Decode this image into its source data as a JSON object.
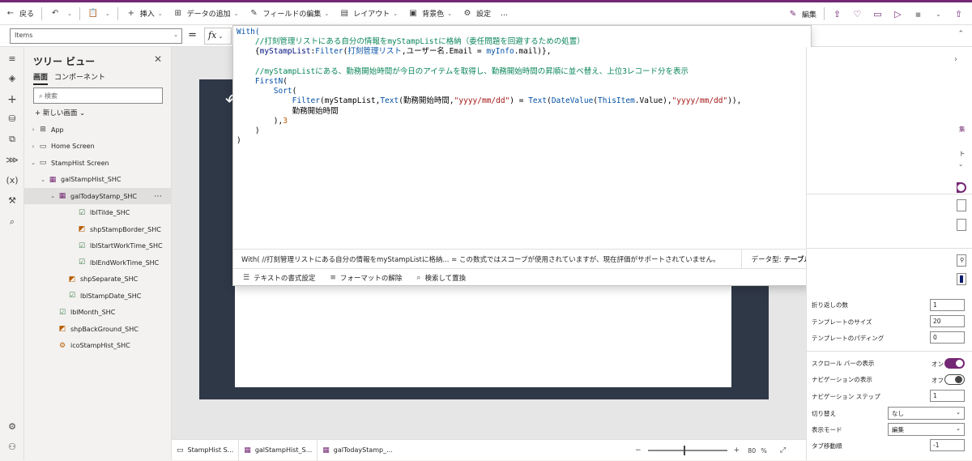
{
  "toolbar": {
    "back": "戻る",
    "insert": "挿入",
    "add_data": "データの追加",
    "edit_fields": "フィールドの編集",
    "layout": "レイアウト",
    "background": "背景色",
    "settings": "設定",
    "more": "…",
    "edit": "編集"
  },
  "formula_bar": {
    "property": "Items",
    "equals": "=",
    "fx": "fx"
  },
  "code_lines": [
    {
      "parts": [
        {
          "t": "With(",
          "c": "fn"
        }
      ]
    },
    {
      "parts": [
        {
          "t": "    //打刻管理リストにある自分の情報をmyStampListに格納（委任問題を回避するための処置）",
          "c": "cm"
        }
      ]
    },
    {
      "parts": [
        {
          "t": "    {",
          "c": ""
        },
        {
          "t": "myStampList",
          "c": "var"
        },
        {
          "t": ":",
          "c": ""
        },
        {
          "t": "Filter",
          "c": "fn"
        },
        {
          "t": "(",
          "c": ""
        },
        {
          "t": "打刻管理リスト",
          "c": "fn"
        },
        {
          "t": ",ユーザー名.Email = ",
          "c": ""
        },
        {
          "t": "myInfo",
          "c": "fn"
        },
        {
          "t": ".mail)},",
          "c": ""
        }
      ]
    },
    {
      "parts": [
        {
          "t": "",
          "c": ""
        }
      ]
    },
    {
      "parts": [
        {
          "t": "    //myStampListにある、勤務開始時間が今日のアイテムを取得し、勤務開始時間の昇順に並べ替え、上位3レコード分を表示",
          "c": "cm"
        }
      ]
    },
    {
      "parts": [
        {
          "t": "    FirstN",
          "c": "fn"
        },
        {
          "t": "(",
          "c": ""
        }
      ]
    },
    {
      "parts": [
        {
          "t": "        Sort",
          "c": "fn"
        },
        {
          "t": "(",
          "c": ""
        }
      ]
    },
    {
      "parts": [
        {
          "t": "            Filter",
          "c": "fn"
        },
        {
          "t": "(myStampList,",
          "c": ""
        },
        {
          "t": "Text",
          "c": "fn"
        },
        {
          "t": "(勤務開始時間,",
          "c": ""
        },
        {
          "t": "\"yyyy/mm/dd\"",
          "c": "str"
        },
        {
          "t": ") = ",
          "c": ""
        },
        {
          "t": "Text",
          "c": "fn"
        },
        {
          "t": "(",
          "c": ""
        },
        {
          "t": "DateValue",
          "c": "fn"
        },
        {
          "t": "(",
          "c": ""
        },
        {
          "t": "ThisItem",
          "c": "fn"
        },
        {
          "t": ".Value),",
          "c": ""
        },
        {
          "t": "\"yyyy/mm/dd\"",
          "c": "str"
        },
        {
          "t": ")),",
          "c": ""
        }
      ]
    },
    {
      "parts": [
        {
          "t": "            勤務開始時間",
          "c": ""
        }
      ]
    },
    {
      "parts": [
        {
          "t": "        ),",
          "c": ""
        },
        {
          "t": "3",
          "c": "num"
        }
      ]
    },
    {
      "parts": [
        {
          "t": "    )",
          "c": ""
        }
      ]
    },
    {
      "parts": [
        {
          "t": ")",
          "c": ""
        }
      ]
    }
  ],
  "editor_status": {
    "message": "With( //打刻管理リストにある自分の情報をmyStampListに格納...  =  この数式ではスコープが使用されていますが、現在評価がサポートされていません。",
    "type_label": "データ型:",
    "type_value": "テーブル"
  },
  "editor_tools": {
    "format_text": "テキストの書式設定",
    "remove_format": "フォーマットの解除",
    "find_replace": "検索して置換"
  },
  "tree": {
    "title": "ツリー ビュー",
    "tab_screens": "画面",
    "tab_components": "コンポーネント",
    "search_placeholder": "検索",
    "new_screen": "新しい画面",
    "items": [
      {
        "label": "App",
        "icon": "app-icon",
        "exp": "›",
        "indent": 0
      },
      {
        "label": "Home Screen",
        "icon": "screen-icon",
        "exp": "›",
        "indent": 0
      },
      {
        "label": "StampHist Screen",
        "icon": "screen-icon",
        "exp": "⌄",
        "indent": 0
      },
      {
        "label": "galStampHist_SHC",
        "icon": "gallery-icon",
        "exp": "⌄",
        "indent": 1
      },
      {
        "label": "galTodayStamp_SHC",
        "icon": "gallery-icon",
        "exp": "⌄",
        "indent": 2
      },
      {
        "label": "lblTilde_SHC",
        "icon": "label-icon",
        "exp": "",
        "indent": 4
      },
      {
        "label": "shpStampBorder_SHC",
        "icon": "shape-icon",
        "exp": "",
        "indent": 4
      },
      {
        "label": "lblStartWorkTime_SHC",
        "icon": "label-icon",
        "exp": "",
        "indent": 4
      },
      {
        "label": "lblEndWorkTime_SHC",
        "icon": "label-icon",
        "exp": "",
        "indent": 4
      },
      {
        "label": "shpSeparate_SHC",
        "icon": "shape-icon",
        "exp": "",
        "indent": 3
      },
      {
        "label": "lblStampDate_SHC",
        "icon": "label-icon",
        "exp": "",
        "indent": 3
      },
      {
        "label": "lblMonth_SHC",
        "icon": "label-icon",
        "exp": "",
        "indent": 2
      },
      {
        "label": "shpBackGround_SHC",
        "icon": "shape-icon",
        "exp": "",
        "indent": 2
      },
      {
        "label": "icoStampHist_SHC",
        "icon": "icon-control-icon",
        "exp": "",
        "indent": 2
      }
    ]
  },
  "props": {
    "frag_edit": "集",
    "frag_t": "ト",
    "wrap_count_label": "折り返しの数",
    "wrap_count": "1",
    "template_size_label": "テンプレートのサイズ",
    "template_size": "20",
    "template_padding_label": "テンプレートのパディング",
    "template_padding": "0",
    "scrollbar_label": "スクロール バーの表示",
    "scrollbar_state": "オン",
    "nav_label": "ナビゲーションの表示",
    "nav_state": "オフ",
    "nav_step_label": "ナビゲーション ステップ",
    "nav_step": "1",
    "transition_label": "切り替え",
    "transition": "なし",
    "display_mode_label": "表示モード",
    "display_mode": "編集",
    "tab_index_label": "タブ移動順",
    "tab_index": "-1",
    "accent_color": "#0a1a6b"
  },
  "status": {
    "crumb1": "StampHist S...",
    "crumb2": "galStampHist_S...",
    "crumb3": "galTodayStamp_...",
    "zoom_minus": "−",
    "zoom_plus": "+",
    "zoom_value": "80",
    "zoom_pct": "%",
    "zoom_level": 0.45
  },
  "colors": {
    "brand": "#742774",
    "screen_bg": "#2f3847"
  }
}
